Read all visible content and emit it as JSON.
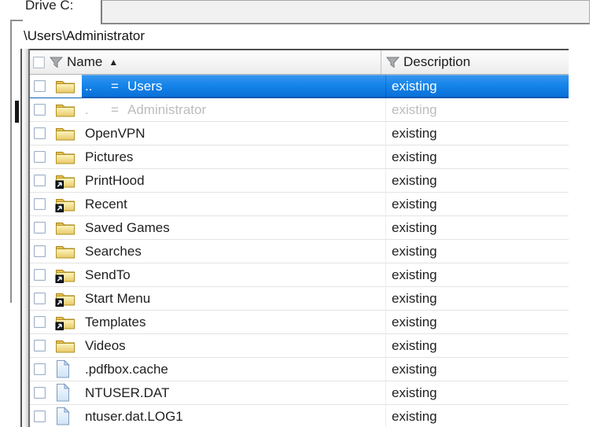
{
  "window": {
    "tab_label": "Drive C:",
    "path": "\\Users\\Administrator"
  },
  "table": {
    "link_symbol": "=",
    "sort_icon": "▲",
    "columns": [
      {
        "label": "Name",
        "sorted": "asc",
        "filter": true
      },
      {
        "label": "Description",
        "filter": true
      }
    ],
    "rows": [
      {
        "name": "..",
        "alias": "Users",
        "icon": "folder",
        "desc": "existing",
        "state": "selected"
      },
      {
        "name": ".",
        "alias": "Administrator",
        "icon": "folder",
        "desc": "existing",
        "state": "dimmed"
      },
      {
        "name": "OpenVPN",
        "icon": "folder",
        "desc": "existing"
      },
      {
        "name": "Pictures",
        "icon": "folder",
        "desc": "existing"
      },
      {
        "name": "PrintHood",
        "icon": "folder-shortcut",
        "desc": "existing"
      },
      {
        "name": "Recent",
        "icon": "folder-shortcut",
        "desc": "existing"
      },
      {
        "name": "Saved Games",
        "icon": "folder",
        "desc": "existing"
      },
      {
        "name": "Searches",
        "icon": "folder",
        "desc": "existing"
      },
      {
        "name": "SendTo",
        "icon": "folder-shortcut",
        "desc": "existing"
      },
      {
        "name": "Start Menu",
        "icon": "folder-shortcut",
        "desc": "existing"
      },
      {
        "name": "Templates",
        "icon": "folder-shortcut",
        "desc": "existing"
      },
      {
        "name": "Videos",
        "icon": "folder",
        "desc": "existing"
      },
      {
        "name": ".pdfbox.cache",
        "icon": "file",
        "desc": "existing"
      },
      {
        "name": "NTUSER.DAT",
        "icon": "file",
        "desc": "existing"
      },
      {
        "name": "ntuser.dat.LOG1",
        "icon": "file",
        "desc": "existing"
      }
    ],
    "colors": {
      "selection_top": "#1f88ea",
      "selection_bottom": "#0b6fd8",
      "dimmed_text": "#bcbcbc",
      "text": "#1f1f1f"
    }
  }
}
